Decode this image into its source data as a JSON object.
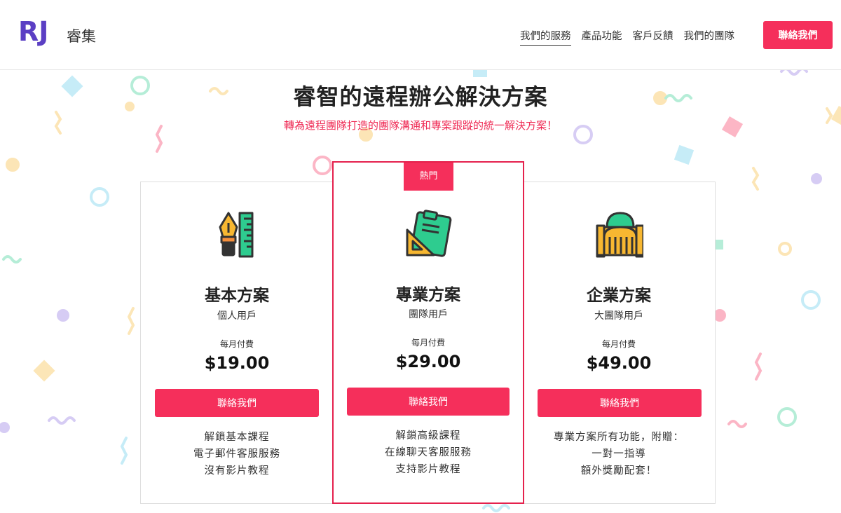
{
  "brand": {
    "logo_text": "RJ",
    "name": "睿集"
  },
  "nav": {
    "items": [
      "我們的服務",
      "產品功能",
      "客戶反饋",
      "我們的團隊"
    ],
    "cta_label": "聯絡我們"
  },
  "hero": {
    "title": "睿智的遠程辦公解決方案",
    "subtitle": "轉為遠程團隊打造的團隊溝通和專案跟蹤的統一解決方案！"
  },
  "plans": [
    {
      "name": "基本方案",
      "audience": "個人用戶",
      "period": "每月付費",
      "price": "$19.00",
      "button_label": "聯絡我們",
      "features": [
        "解鎖基本課程",
        "電子郵件客服服務",
        "沒有影片教程"
      ],
      "icon": "pen-ruler-icon"
    },
    {
      "badge": "熱門",
      "name": "專業方案",
      "audience": "團隊用戶",
      "period": "每月付費",
      "price": "$29.00",
      "button_label": "聯絡我們",
      "features": [
        "解鎖高級課程",
        "在線聊天客服服務",
        "支持影片教程"
      ],
      "icon": "clipboard-set-square-icon"
    },
    {
      "name": "企業方案",
      "audience": "大團隊用戶",
      "period": "每月付費",
      "price": "$49.00",
      "button_label": "聯絡我們",
      "features": [
        "專業方案所有功能，附贈：",
        "一對一指導",
        "額外獎勵配套！"
      ],
      "icon": "building-icon"
    }
  ],
  "colors": {
    "accent": "#f52f5b",
    "logo": "#5b3fc4",
    "icon_outline": "#333333",
    "icon_yellow": "#f7b731",
    "icon_green": "#2ecc8f",
    "icon_orange": "#f58f3c"
  }
}
